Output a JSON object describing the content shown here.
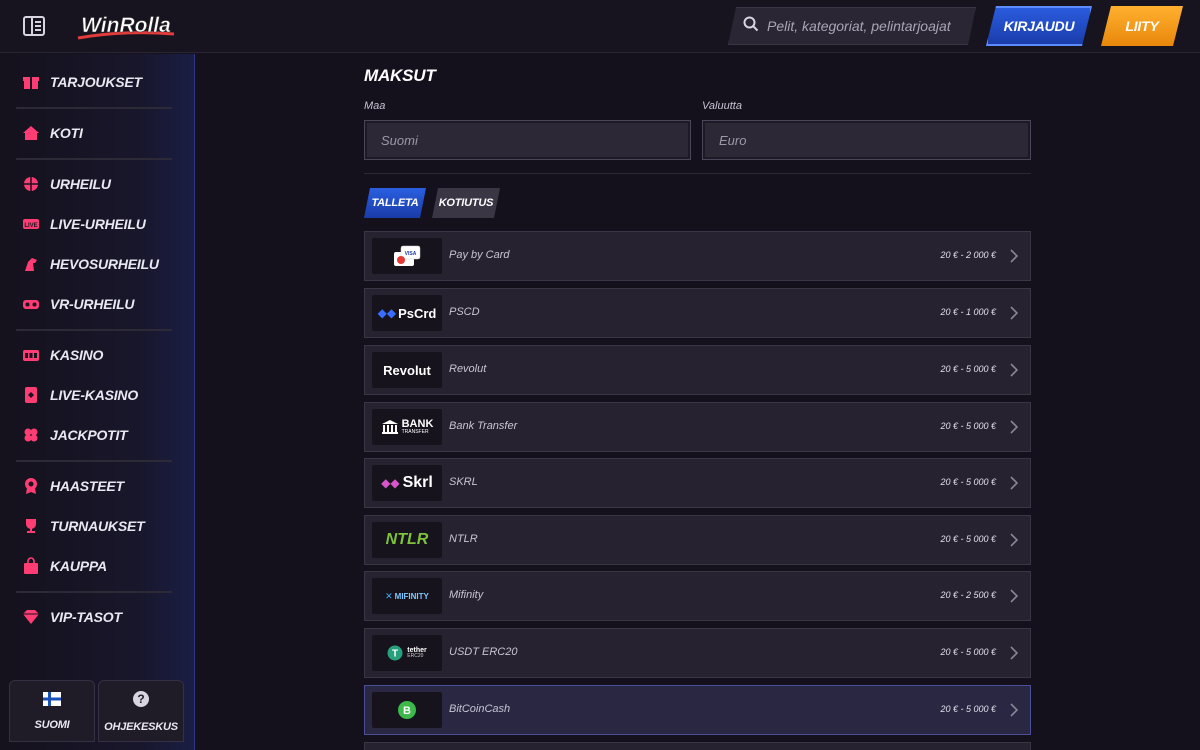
{
  "header": {
    "logo_text": "WinRolla",
    "search_placeholder": "Pelit, kategoriat, pelintarjoajat",
    "login_label": "Kirjaudu",
    "join_label": "Liity"
  },
  "sidebar": {
    "items": [
      {
        "label": "Tarjoukset",
        "icon": "gift-icon"
      },
      {
        "label": "Koti",
        "icon": "home-icon"
      },
      {
        "label": "Urheilu",
        "icon": "ball-icon"
      },
      {
        "label": "Live-urheilu",
        "icon": "live-icon"
      },
      {
        "label": "Hevosurheilu",
        "icon": "horse-icon"
      },
      {
        "label": "VR-urheilu",
        "icon": "vr-icon"
      },
      {
        "label": "Kasino",
        "icon": "slot-icon"
      },
      {
        "label": "Live-kasino",
        "icon": "card-icon"
      },
      {
        "label": "Jackpotit",
        "icon": "clover-icon"
      },
      {
        "label": "Haasteet",
        "icon": "badge-icon"
      },
      {
        "label": "Turnaukset",
        "icon": "trophy-icon"
      },
      {
        "label": "Kauppa",
        "icon": "bag-icon"
      },
      {
        "label": "VIP-tasot",
        "icon": "diamond-icon"
      }
    ],
    "language_label": "Suomi",
    "help_label": "Ohjekeskus"
  },
  "main": {
    "title": "Maksut",
    "country_label": "Maa",
    "country_value": "Suomi",
    "currency_label": "Valuutta",
    "currency_value": "Euro",
    "tab_deposit": "Talleta",
    "tab_withdraw": "Kotiutus",
    "methods": [
      {
        "name": "Pay by Card",
        "range": "20 € - 2 000 €",
        "logo": "VISA"
      },
      {
        "name": "PSCD",
        "range": "20 € - 1 000 €",
        "logo": "PsCrd"
      },
      {
        "name": "Revolut",
        "range": "20 € - 5 000 €",
        "logo": "Revolut"
      },
      {
        "name": "Bank Transfer",
        "range": "20 € - 5 000 €",
        "logo": "BANK",
        "logo_sub": "TRANSFER"
      },
      {
        "name": "SKRL",
        "range": "20 € - 5 000 €",
        "logo": "Skrl"
      },
      {
        "name": "NTLR",
        "range": "20 € - 5 000 €",
        "logo": "NTLR"
      },
      {
        "name": "Mifinity",
        "range": "20 € - 2 500 €",
        "logo": "MIFINITY"
      },
      {
        "name": "USDT ERC20",
        "range": "20 € - 5 000 €",
        "logo": "tether",
        "logo_sub": "ERC20"
      },
      {
        "name": "BitCoinCash",
        "range": "20 € - 5 000 €",
        "logo": "B"
      }
    ]
  },
  "colors": {
    "accent_blue": "#2b5de0",
    "accent_orange": "#f39a1c",
    "accent_pink": "#ff3d74"
  }
}
